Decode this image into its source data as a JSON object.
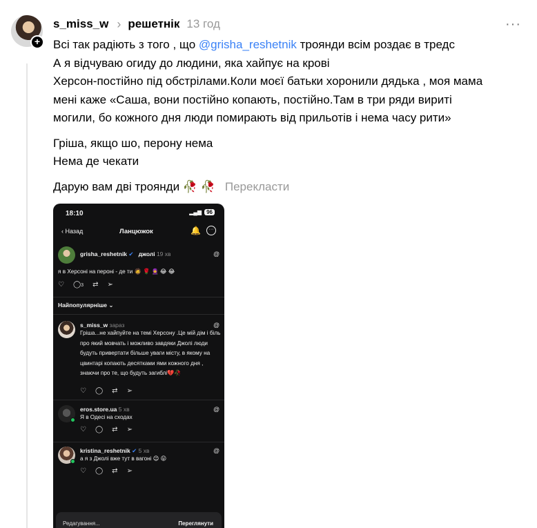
{
  "post": {
    "username": "s_miss_w",
    "reply_to": "решетнік",
    "time": "13 год",
    "lines": [
      {
        "pre": "Всі так радіють з того , що ",
        "mention": "@grisha_reshetnik",
        "post": " троянди всім роздає в тредс"
      },
      {
        "text": "А я відчуваю огиду до людини, яка хайпує на крові"
      },
      {
        "text": "Херсон-постійно під обстрілами.Коли моєї батьки хоронили дядька , моя мама"
      },
      {
        "text": "мені каже «Саша, вони постійно копають, постійно.Там в три ряди вириті"
      },
      {
        "text": "могили, бо кожного дня люди помирають від прильотів і нема часу рити»"
      }
    ],
    "para2": [
      "Гріша, якщо шо, перону нема",
      "Нема де чекати"
    ],
    "para3": "Дарую вам дві троянди 🥀 🥀",
    "translate_label": "Перекласти"
  },
  "screenshot": {
    "status_time": "18:10",
    "battery": "96",
    "back_label": "Назад",
    "title": "Ланцюжок",
    "main_post": {
      "user": "grisha_reshetnik",
      "tag": "джолі",
      "time": "19 хв",
      "text": "я в Херсоні на пероні - де ти 🧔 🌹 🧕 😂 😂",
      "replies": "3"
    },
    "sort_label": "Найпопулярніше ⌄",
    "replies": [
      {
        "user": "s_miss_w",
        "time": "зараз",
        "text": "Гріша...не хайпуйте на темі Херсону .Це мій дім і біль про який мовчать і можливо завдяки Джолі люди будуть привертати більше уваги місту, в якому на цвинтарі копають десятками ями кожного дня , знаючи про те, що будуть загиблі💔🥀"
      },
      {
        "user": "eros.store.ua",
        "time": "5 хв",
        "text": "Я в Одесі на сходах"
      },
      {
        "user": "kristina_reshetnik",
        "time": "5 хв",
        "text": "а я з Джолі вже тут в вагоні 😉 😛"
      }
    ],
    "draft_label": "Редагування...",
    "draft_action": "Переглянути"
  },
  "icons": {
    "chevron": "›",
    "more": "···",
    "threads": "@",
    "heart": "♡",
    "comment": "◯",
    "repost": "⇄",
    "share": "➢"
  }
}
